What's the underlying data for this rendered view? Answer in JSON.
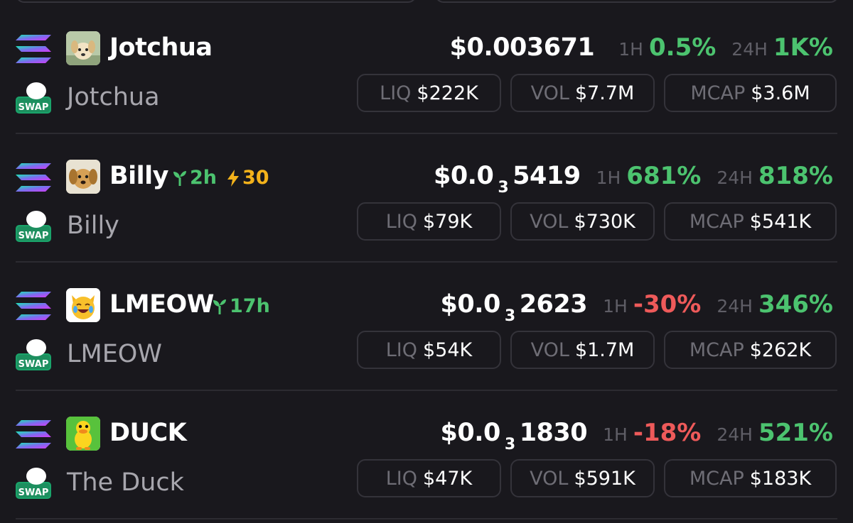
{
  "labels": {
    "h1": "1H",
    "h24": "24H",
    "liq": "LIQ",
    "vol": "VOL",
    "mcap": "MCAP",
    "swap": "SWAP"
  },
  "colors": {
    "up": "#4cc36f",
    "down": "#ee5a5a",
    "boost": "#f3b21b",
    "background": "#19181d",
    "border": "#34333a"
  },
  "tokens": [
    {
      "symbol": "Jotchua",
      "name": "Jotchua",
      "chain_icon": "solana-icon",
      "avatar": "puppy-avatar",
      "age": null,
      "boost": null,
      "price": {
        "prefix": "$0.003671",
        "zeros": "",
        "digits": ""
      },
      "change_1h": "0.5%",
      "change_1h_dir": "up",
      "change_24h": "1K%",
      "change_24h_dir": "up",
      "liq": "$222K",
      "vol": "$7.7M",
      "mcap": "$3.6M"
    },
    {
      "symbol": "Billy",
      "name": "Billy",
      "chain_icon": "solana-icon",
      "avatar": "puppy-avatar",
      "age": "2h",
      "boost": "30",
      "price": {
        "prefix": "$0.0",
        "zeros": "3",
        "digits": "5419"
      },
      "change_1h": "681%",
      "change_1h_dir": "up",
      "change_24h": "818%",
      "change_24h_dir": "up",
      "liq": "$79K",
      "vol": "$730K",
      "mcap": "$541K"
    },
    {
      "symbol": "LMEOW",
      "name": "LMEOW",
      "chain_icon": "solana-icon",
      "avatar": "laughing-cat-avatar",
      "age": "17h",
      "boost": null,
      "price": {
        "prefix": "$0.0",
        "zeros": "3",
        "digits": "2623"
      },
      "change_1h": "-30%",
      "change_1h_dir": "down",
      "change_24h": "346%",
      "change_24h_dir": "up",
      "liq": "$54K",
      "vol": "$1.7M",
      "mcap": "$262K"
    },
    {
      "symbol": "DUCK",
      "name": "The Duck",
      "chain_icon": "solana-icon",
      "avatar": "duck-avatar",
      "age": null,
      "boost": null,
      "price": {
        "prefix": "$0.0",
        "zeros": "3",
        "digits": "1830"
      },
      "change_1h": "-18%",
      "change_1h_dir": "down",
      "change_24h": "521%",
      "change_24h_dir": "up",
      "liq": "$47K",
      "vol": "$591K",
      "mcap": "$183K"
    }
  ]
}
